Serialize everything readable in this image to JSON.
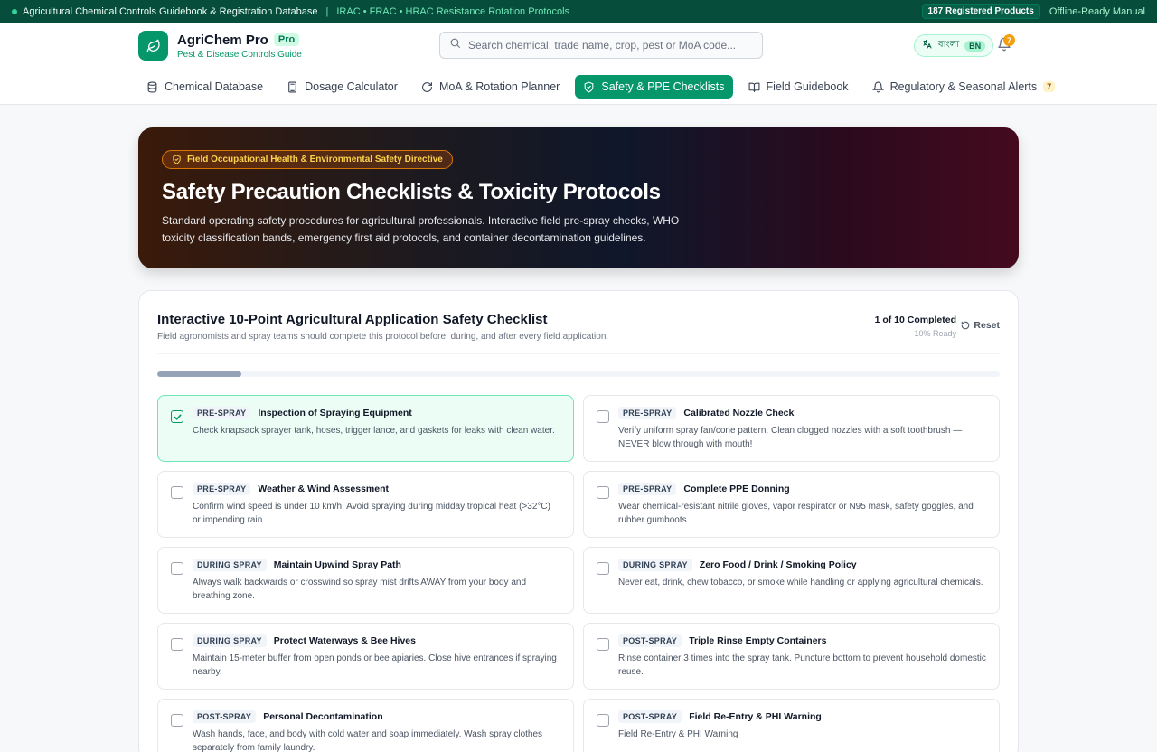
{
  "topbar": {
    "title": "Agricultural Chemical Controls Guidebook & Registration Database",
    "separator": "|",
    "protocols": "IRAC • FRAC • HRAC Resistance Rotation Protocols",
    "registered": "187 Registered Products",
    "offline": "Offline-Ready Manual"
  },
  "header": {
    "brand_name": "AgriChem Pro",
    "pro_badge": "Pro",
    "brand_sub": "Pest & Disease Controls Guide",
    "search_placeholder": "Search chemical, trade name, crop, pest or MoA code...",
    "lang_label": "বাংলা",
    "lang_code": "BN",
    "notification_count": "7"
  },
  "nav": {
    "items": [
      {
        "label": "Chemical Database",
        "icon": "database-icon"
      },
      {
        "label": "Dosage Calculator",
        "icon": "calculator-icon"
      },
      {
        "label": "MoA & Rotation Planner",
        "icon": "rotate-icon"
      },
      {
        "label": "Safety & PPE Checklists",
        "icon": "shield-check-icon",
        "active": true
      },
      {
        "label": "Field Guidebook",
        "icon": "book-icon"
      },
      {
        "label": "Regulatory & Seasonal Alerts",
        "icon": "bell-icon",
        "count": "7"
      }
    ]
  },
  "hero": {
    "directive": "Field Occupational Health & Environmental Safety Directive",
    "title": "Safety Precaution Checklists & Toxicity Protocols",
    "description": "Standard operating safety procedures for agricultural professionals. Interactive field pre-spray checks, WHO toxicity classification bands, emergency first aid protocols, and container decontamination guidelines."
  },
  "checklist": {
    "title": "Interactive 10-Point Agricultural Application Safety Checklist",
    "subtitle": "Field agronomists and spray teams should complete this protocol before, during, and after every field application.",
    "completed_text": "1 of 10 Completed",
    "ready_text": "10% Ready",
    "progress_fraction": 0.1,
    "reset_label": "Reset",
    "items": [
      {
        "phase": "PRE-SPRAY",
        "title": "Inspection of Spraying Equipment",
        "desc": "Check knapsack sprayer tank, hoses, trigger lance, and gaskets for leaks with clean water.",
        "checked": true
      },
      {
        "phase": "PRE-SPRAY",
        "title": "Calibrated Nozzle Check",
        "desc": "Verify uniform spray fan/cone pattern. Clean clogged nozzles with a soft toothbrush — NEVER blow through with mouth!",
        "checked": false
      },
      {
        "phase": "PRE-SPRAY",
        "title": "Weather & Wind Assessment",
        "desc": "Confirm wind speed is under 10 km/h. Avoid spraying during midday tropical heat (>32°C) or impending rain.",
        "checked": false
      },
      {
        "phase": "PRE-SPRAY",
        "title": "Complete PPE Donning",
        "desc": "Wear chemical-resistant nitrile gloves, vapor respirator or N95 mask, safety goggles, and rubber gumboots.",
        "checked": false
      },
      {
        "phase": "DURING SPRAY",
        "title": "Maintain Upwind Spray Path",
        "desc": "Always walk backwards or crosswind so spray mist drifts AWAY from your body and breathing zone.",
        "checked": false
      },
      {
        "phase": "DURING SPRAY",
        "title": "Zero Food / Drink / Smoking Policy",
        "desc": "Never eat, drink, chew tobacco, or smoke while handling or applying agricultural chemicals.",
        "checked": false
      },
      {
        "phase": "DURING SPRAY",
        "title": "Protect Waterways & Bee Hives",
        "desc": "Maintain 15-meter buffer from open ponds or bee apiaries. Close hive entrances if spraying nearby.",
        "checked": false
      },
      {
        "phase": "POST-SPRAY",
        "title": "Triple Rinse Empty Containers",
        "desc": "Rinse container 3 times into the spray tank. Puncture bottom to prevent household domestic reuse.",
        "checked": false
      },
      {
        "phase": "POST-SPRAY",
        "title": "Personal Decontamination",
        "desc": "Wash hands, face, and body with cold water and soap immediately. Wash spray clothes separately from family laundry.",
        "checked": false
      },
      {
        "phase": "POST-SPRAY",
        "title": "Field Re-Entry & PHI Warning",
        "desc": "Field Re-Entry & PHI Warning",
        "checked": false
      }
    ]
  },
  "colors": {
    "brand": "#059669",
    "topbar": "#064e3b",
    "accent_badge": "#f59e0b"
  }
}
